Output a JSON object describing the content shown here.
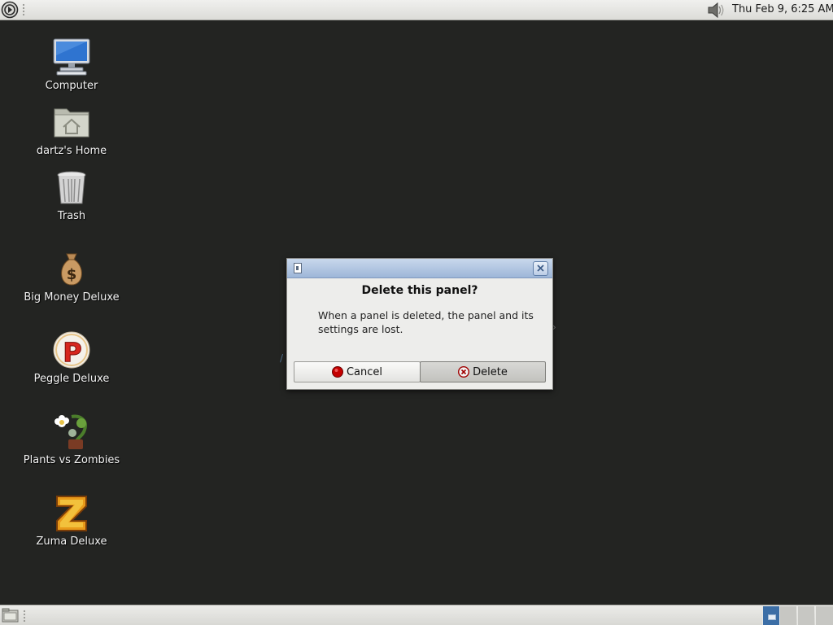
{
  "top_panel": {
    "clock": "Thu Feb  9,  6:25 AM"
  },
  "desktop": {
    "icons": [
      {
        "label": "Computer",
        "icon": "computer-icon"
      },
      {
        "label": "dartz's Home",
        "icon": "home-folder-icon"
      },
      {
        "label": "Trash",
        "icon": "trash-icon"
      },
      {
        "label": "Big Money Deluxe",
        "icon": "money-bag-icon"
      },
      {
        "label": "Peggle Deluxe",
        "icon": "peggle-icon"
      },
      {
        "label": "Plants vs Zombies",
        "icon": "plants-vs-zombies-icon"
      },
      {
        "label": "Zuma Deluxe",
        "icon": "zuma-icon"
      }
    ]
  },
  "dialog": {
    "title": "Delete this panel?",
    "message": "When a panel is deleted, the panel and its settings are lost.",
    "cancel_label": "Cancel",
    "delete_label": "Delete"
  },
  "bottom_panel": {
    "workspaces": 4,
    "active_workspace": 1
  },
  "colors": {
    "desktop_bg": "#232422",
    "panel_bg": "#e6e6e3",
    "titlebar": "#b4c8e3",
    "active_workspace": "#3c6ea6"
  }
}
